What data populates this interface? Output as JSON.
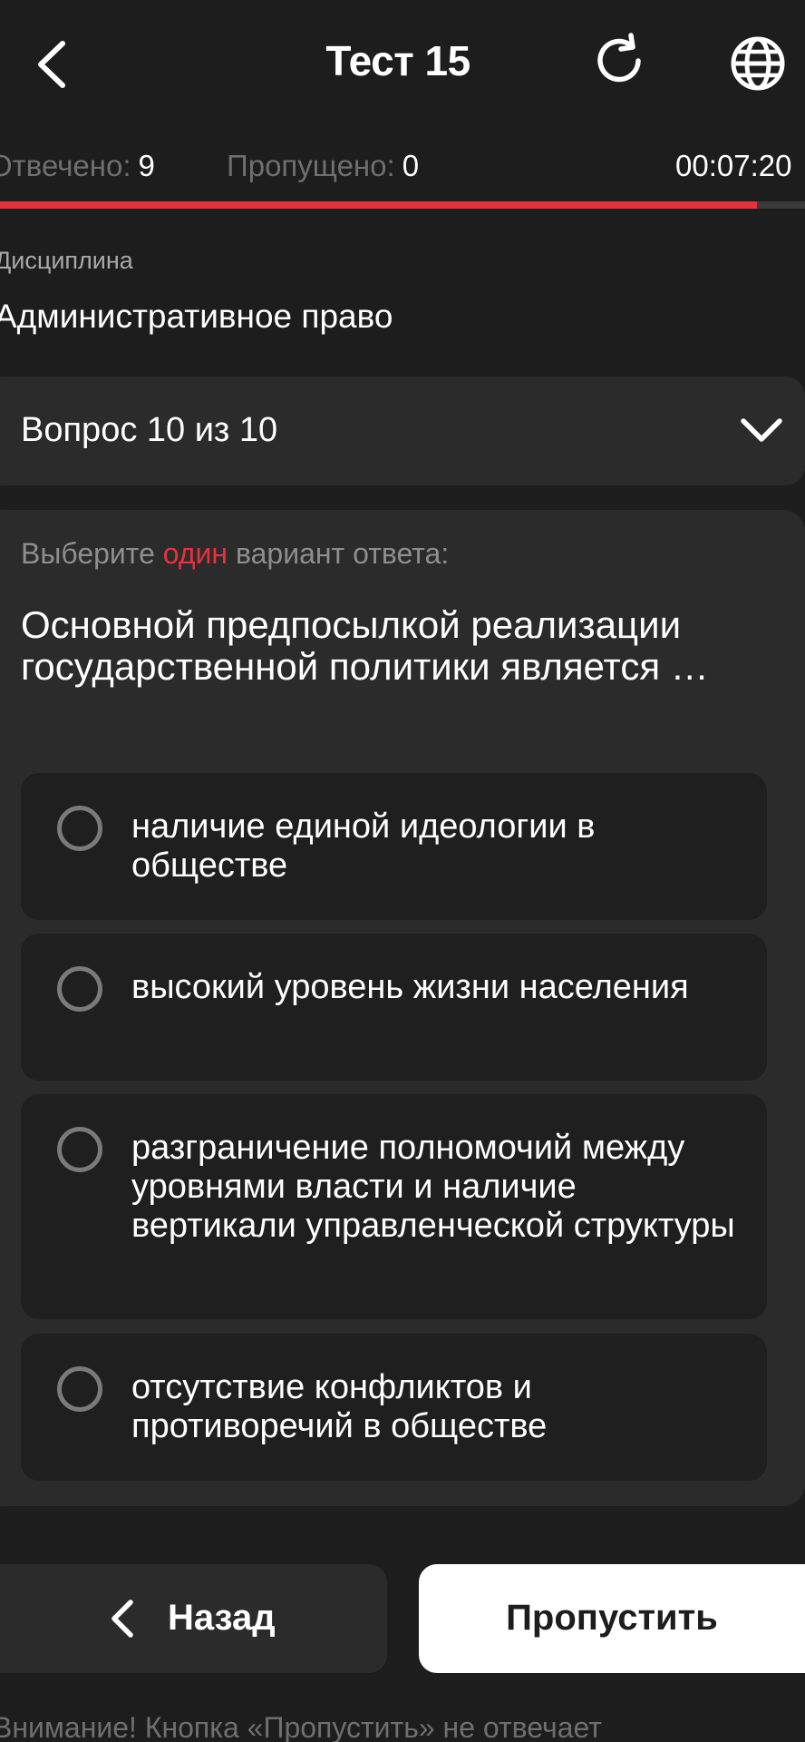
{
  "header": {
    "title": "Тест 15",
    "back_icon": "chevron-left-icon",
    "reload_icon": "reload-icon",
    "language_icon": "globe-icon"
  },
  "stats": {
    "answered_label": "Отвечено:",
    "answered_value": "9",
    "skipped_label": "Пропущено:",
    "skipped_value": "0",
    "timer": "00:07:20"
  },
  "progress": {
    "fraction": 0.94,
    "color": "#e8323a"
  },
  "discipline": {
    "label": "Дисциплина",
    "value": "Административное право"
  },
  "question_selector": {
    "label": "Вопрос 10 из 10"
  },
  "question": {
    "hint_before": "Выберите ",
    "hint_accent": "один",
    "hint_after": " вариант ответа:",
    "text": "Основной предпосылкой реализации государственной политики является …",
    "options": [
      "наличие единой идеологии в обществе",
      "высокий уровень жизни населения",
      "разграничение полномочий между уровнями власти и наличие вертикали управленческой структуры",
      "отсутствие конфликтов и противоречий в обществе"
    ]
  },
  "footer": {
    "back_label": "Назад",
    "skip_label": "Пропустить",
    "note": "Внимание! Кнопка «Пропустить» не отвечает"
  },
  "colors": {
    "background": "#1d1d1d",
    "card": "#2b2b2b",
    "accent": "#e8323a"
  }
}
